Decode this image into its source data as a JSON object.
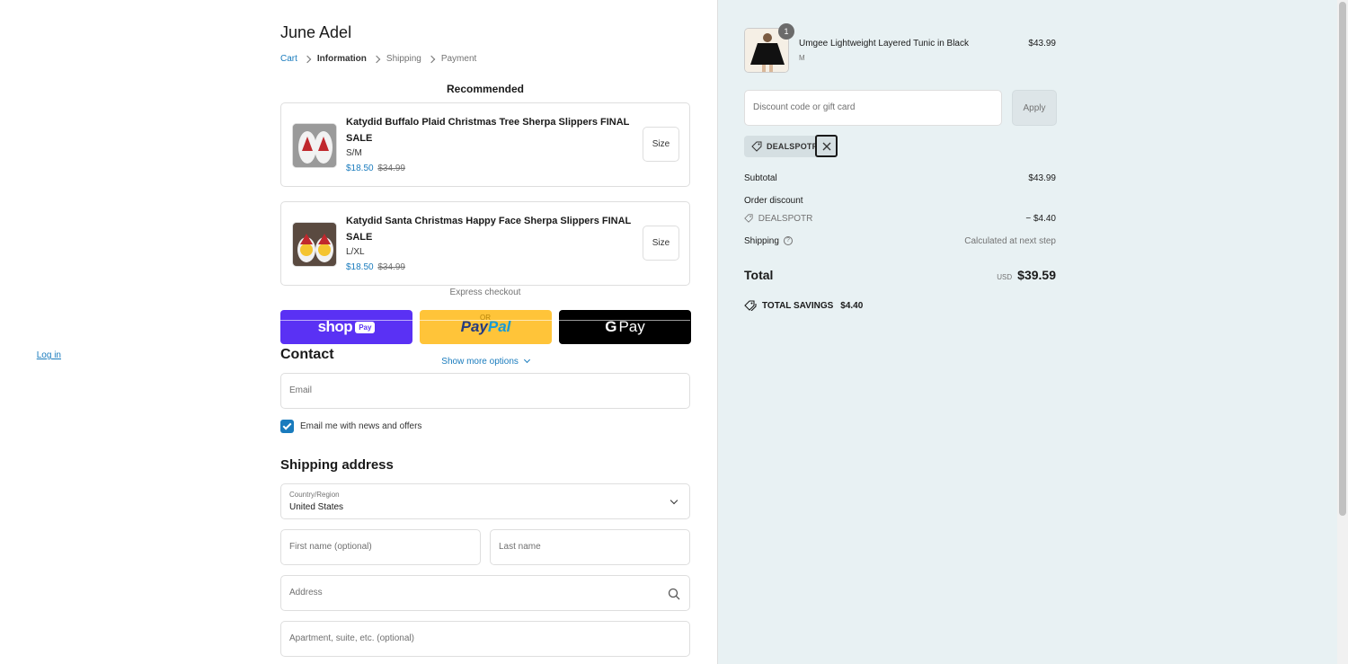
{
  "store": {
    "name": "June Adel"
  },
  "breadcrumb": [
    {
      "label": "Cart",
      "state": "link"
    },
    {
      "label": "Information",
      "state": "active"
    },
    {
      "label": "Shipping",
      "state": "inactive"
    },
    {
      "label": "Payment",
      "state": "inactive"
    }
  ],
  "recommended": {
    "title": "Recommended",
    "items": [
      {
        "name": "Katydid Buffalo Plaid Christmas Tree Sherpa Slippers FINAL SALE",
        "variant": "S/M",
        "sale_price": "$18.50",
        "compare_price": "$34.99",
        "size_label": "Size"
      },
      {
        "name": "Katydid Santa Christmas Happy Face Sherpa Slippers FINAL SALE",
        "variant": "L/XL",
        "sale_price": "$18.50",
        "compare_price": "$34.99",
        "size_label": "Size"
      }
    ]
  },
  "express": {
    "label": "Express checkout",
    "or_text": "OR",
    "shop_pay": {
      "word": "shop",
      "pill": "Pay",
      "color": "#5a31f4"
    },
    "paypal": {
      "pay": "Pay",
      "pal": "Pal",
      "color": "#ffc439"
    },
    "gpay": {
      "g": "G",
      "word": "Pay",
      "color": "#000000"
    },
    "show_more": "Show more options"
  },
  "contact": {
    "title": "Contact",
    "login_label": "Log in",
    "email_placeholder": "Email",
    "newsletter_label": "Email me with news and offers",
    "newsletter_checked": true
  },
  "shipping": {
    "title": "Shipping address",
    "country_label": "Country/Region",
    "country_value": "United States",
    "first_name_placeholder": "First name (optional)",
    "last_name_placeholder": "Last name",
    "address_placeholder": "Address",
    "apartment_placeholder": "Apartment, suite, etc. (optional)"
  },
  "order": {
    "product": {
      "name": "Umgee Lightweight Layered Tunic in Black",
      "variant": "M",
      "price": "$43.99",
      "quantity": "1"
    },
    "discount_placeholder": "Discount code or gift card",
    "apply_label": "Apply",
    "applied_code": "DEALSPOTR",
    "subtotal_label": "Subtotal",
    "subtotal_value": "$43.99",
    "order_discount_label": "Order discount",
    "discount_code": "DEALSPOTR",
    "discount_value": "− $4.40",
    "shipping_label": "Shipping",
    "shipping_value": "Calculated at next step",
    "total_label": "Total",
    "currency": "USD",
    "total_value": "$39.59",
    "savings_label": "TOTAL SAVINGS",
    "savings_value": "$4.40"
  },
  "colors": {
    "accent": "#197bbd",
    "sidebar_bg": "#e8f1f3"
  }
}
